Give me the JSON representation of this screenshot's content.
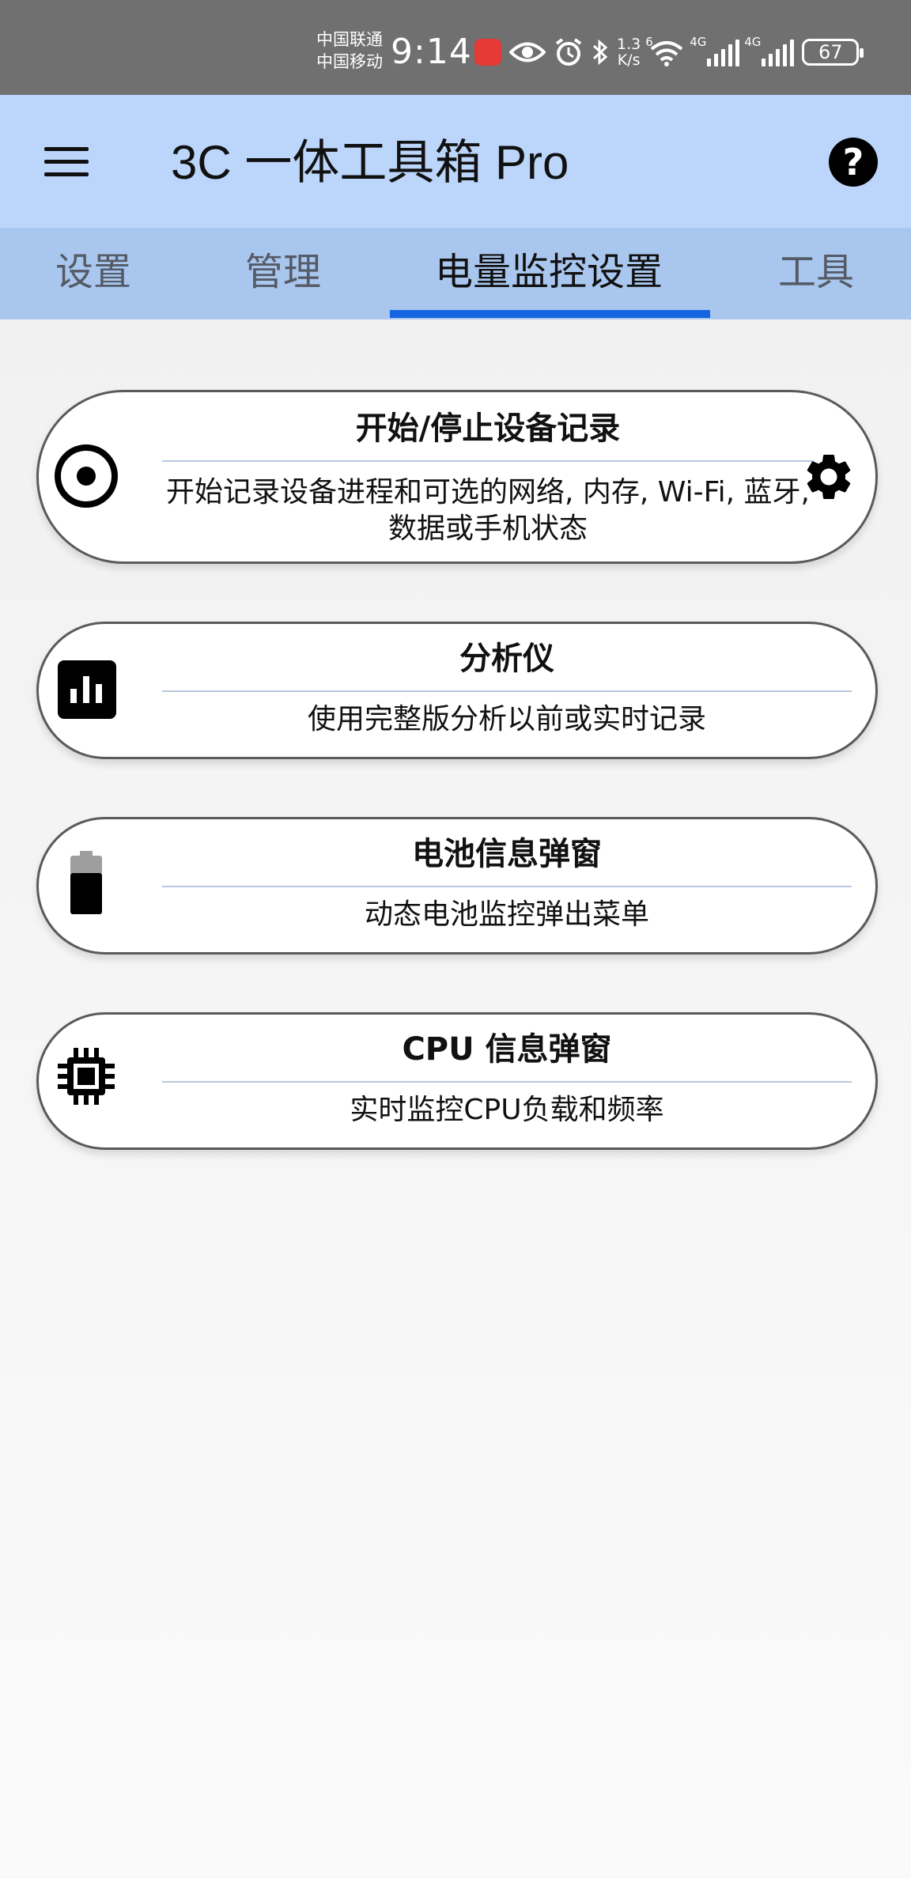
{
  "status_bar": {
    "carrier_1": "中国联通",
    "carrier_2": "中国移动",
    "time": "9:14",
    "net_speed_value": "1.3",
    "net_speed_unit": "K/s",
    "wifi_label": "6",
    "signal_1_label": "4G",
    "signal_2_label": "4G",
    "battery_level": "67"
  },
  "app_bar": {
    "title": "3C 一体工具箱 Pro"
  },
  "tabs": [
    {
      "label": "设置"
    },
    {
      "label": "管理"
    },
    {
      "label": "电量监控设置"
    },
    {
      "label": "工具"
    }
  ],
  "active_tab_index": 2,
  "cards": [
    {
      "icon": "record-icon",
      "title": "开始/停止设备记录",
      "description": "开始记录设备进程和可选的网络, 内存, Wi-Fi, 蓝牙, 数据或手机状态",
      "secondary_icon": "gear-icon"
    },
    {
      "icon": "bar-chart-icon",
      "title": "分析仪",
      "description": "使用完整版分析以前或实时记录"
    },
    {
      "icon": "battery-icon",
      "title": "电池信息弹窗",
      "description": "动态电池监控弹出菜单"
    },
    {
      "icon": "cpu-icon",
      "title": "CPU 信息弹窗",
      "description": "实时监控CPU负载和频率"
    }
  ],
  "colors": {
    "status_bar": "#707070",
    "app_bar": "#bcd6fb",
    "tab_bar": "#a9c7ee",
    "tab_indicator": "#1565e0"
  }
}
